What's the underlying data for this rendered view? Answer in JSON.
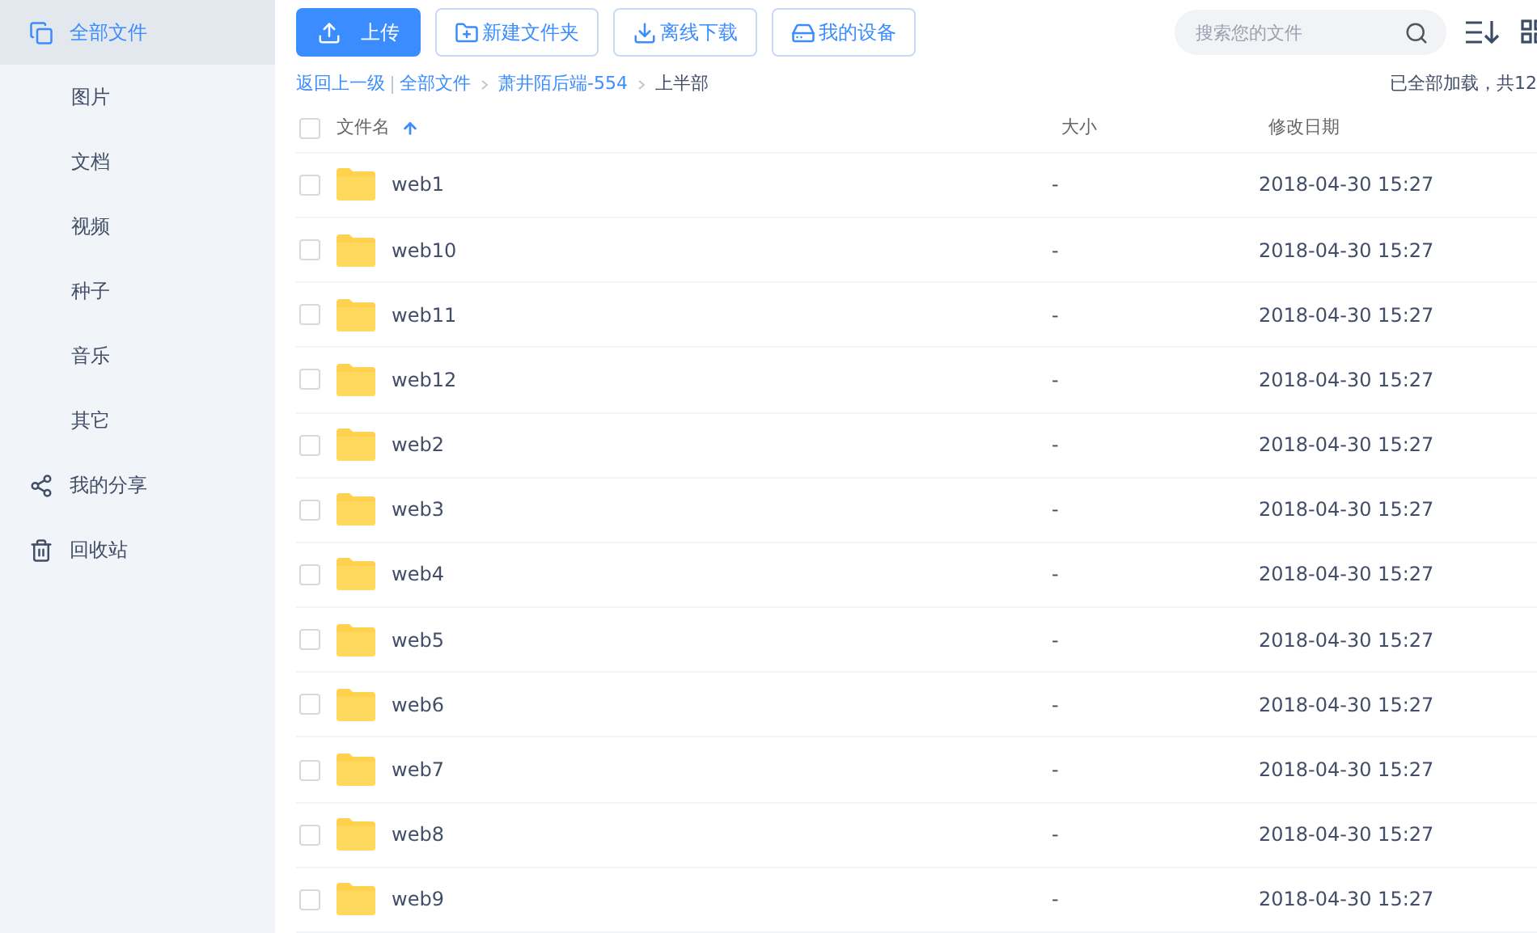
{
  "sidebar": {
    "items": [
      {
        "label": "全部文件",
        "kind": "icon-files",
        "selected": true
      },
      {
        "label": "图片",
        "kind": "sub",
        "selected": false
      },
      {
        "label": "文档",
        "kind": "sub",
        "selected": false
      },
      {
        "label": "视频",
        "kind": "sub",
        "selected": false
      },
      {
        "label": "种子",
        "kind": "sub",
        "selected": false
      },
      {
        "label": "音乐",
        "kind": "sub",
        "selected": false
      },
      {
        "label": "其它",
        "kind": "sub",
        "selected": false
      },
      {
        "label": "我的分享",
        "kind": "icon-share",
        "selected": false
      },
      {
        "label": "回收站",
        "kind": "icon-trash",
        "selected": false
      }
    ]
  },
  "toolbar": {
    "buttons": [
      {
        "label": "上传",
        "kind": "primary"
      },
      {
        "label": "新建文件夹",
        "kind": "outline"
      },
      {
        "label": "离线下载",
        "kind": "outline"
      },
      {
        "label": "我的设备",
        "kind": "outline"
      }
    ],
    "search": {
      "placeholder": "搜索您的文件"
    }
  },
  "breadcrumb": [
    {
      "label": "返回上一级",
      "kind": "back"
    },
    {
      "label": "全部文件",
      "kind": "link"
    },
    {
      "label": "萧井陌后端-554",
      "kind": "link"
    },
    {
      "label": "上半部",
      "kind": "current"
    }
  ],
  "load_status": "已全部加载，共12",
  "table": {
    "columns": [
      "文件名",
      "大小",
      "修改日期"
    ],
    "all_checked": false,
    "rows": [
      {
        "name": "web1",
        "size": "-",
        "date": "2018-04-30 15:27",
        "checked": false
      },
      {
        "name": "web10",
        "size": "-",
        "date": "2018-04-30 15:27",
        "checked": false
      },
      {
        "name": "web11",
        "size": "-",
        "date": "2018-04-30 15:27",
        "checked": false
      },
      {
        "name": "web12",
        "size": "-",
        "date": "2018-04-30 15:27",
        "checked": false
      },
      {
        "name": "web2",
        "size": "-",
        "date": "2018-04-30 15:27",
        "checked": false
      },
      {
        "name": "web3",
        "size": "-",
        "date": "2018-04-30 15:27",
        "checked": false
      },
      {
        "name": "web4",
        "size": "-",
        "date": "2018-04-30 15:27",
        "checked": false
      },
      {
        "name": "web5",
        "size": "-",
        "date": "2018-04-30 15:27",
        "checked": false
      },
      {
        "name": "web6",
        "size": "-",
        "date": "2018-04-30 15:27",
        "checked": false
      },
      {
        "name": "web7",
        "size": "-",
        "date": "2018-04-30 15:27",
        "checked": false
      },
      {
        "name": "web8",
        "size": "-",
        "date": "2018-04-30 15:27",
        "checked": false
      },
      {
        "name": "web9",
        "size": "-",
        "date": "2018-04-30 15:27",
        "checked": false
      }
    ]
  }
}
